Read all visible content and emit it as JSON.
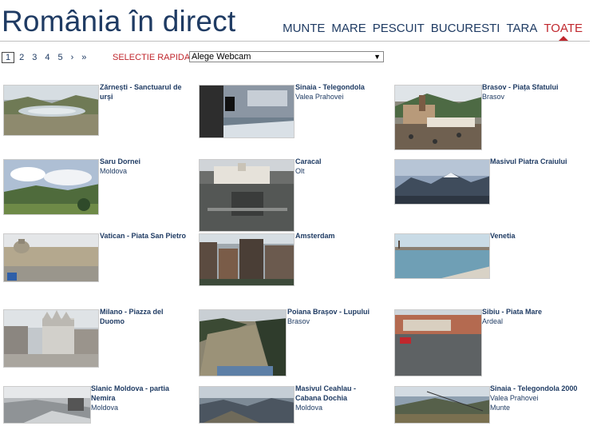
{
  "header": {
    "title": "România în direct"
  },
  "nav": [
    "MUNTE",
    "MARE",
    "PESCUIT",
    "BUCURESTI",
    "TARA",
    "TOATE"
  ],
  "pager": [
    "1",
    "2",
    "3",
    "4",
    "5",
    "›",
    "»"
  ],
  "rapid": {
    "label": "SELECTIE RAPIDA",
    "selected": "Alege Webcam"
  },
  "cams": [
    {
      "title": "Zărnești - Sanctuarul de urși",
      "sub": []
    },
    {
      "title": "Sinaia - Telegondola",
      "sub": [
        "Valea Prahovei"
      ]
    },
    {
      "title": "Brasov - Piața Sfatului",
      "sub": [
        "Brasov"
      ]
    },
    {
      "title": "Saru Dornei",
      "sub": [
        "Moldova"
      ]
    },
    {
      "title": "Caracal",
      "sub": [
        "Olt"
      ]
    },
    {
      "title": "Masivul Piatra Craiului",
      "sub": []
    },
    {
      "title": "Vatican - Piata San Pietro",
      "sub": []
    },
    {
      "title": "Amsterdam",
      "sub": []
    },
    {
      "title": "Venetia",
      "sub": []
    },
    {
      "title": "Milano - Piazza del Duomo",
      "sub": []
    },
    {
      "title": "Poiana Brașov - Lupului",
      "sub": [
        "Brasov"
      ]
    },
    {
      "title": "Sibiu - Piata Mare",
      "sub": [
        "Ardeal"
      ]
    },
    {
      "title": "Slanic Moldova - partia Nemira",
      "sub": [
        "Moldova"
      ]
    },
    {
      "title": "Masivul Ceahlau - Cabana Dochia",
      "sub": [
        "Moldova"
      ]
    },
    {
      "title": "Sinaia - Telegondola 2000",
      "sub": [
        "Valea Prahovei",
        "Munte"
      ]
    }
  ]
}
